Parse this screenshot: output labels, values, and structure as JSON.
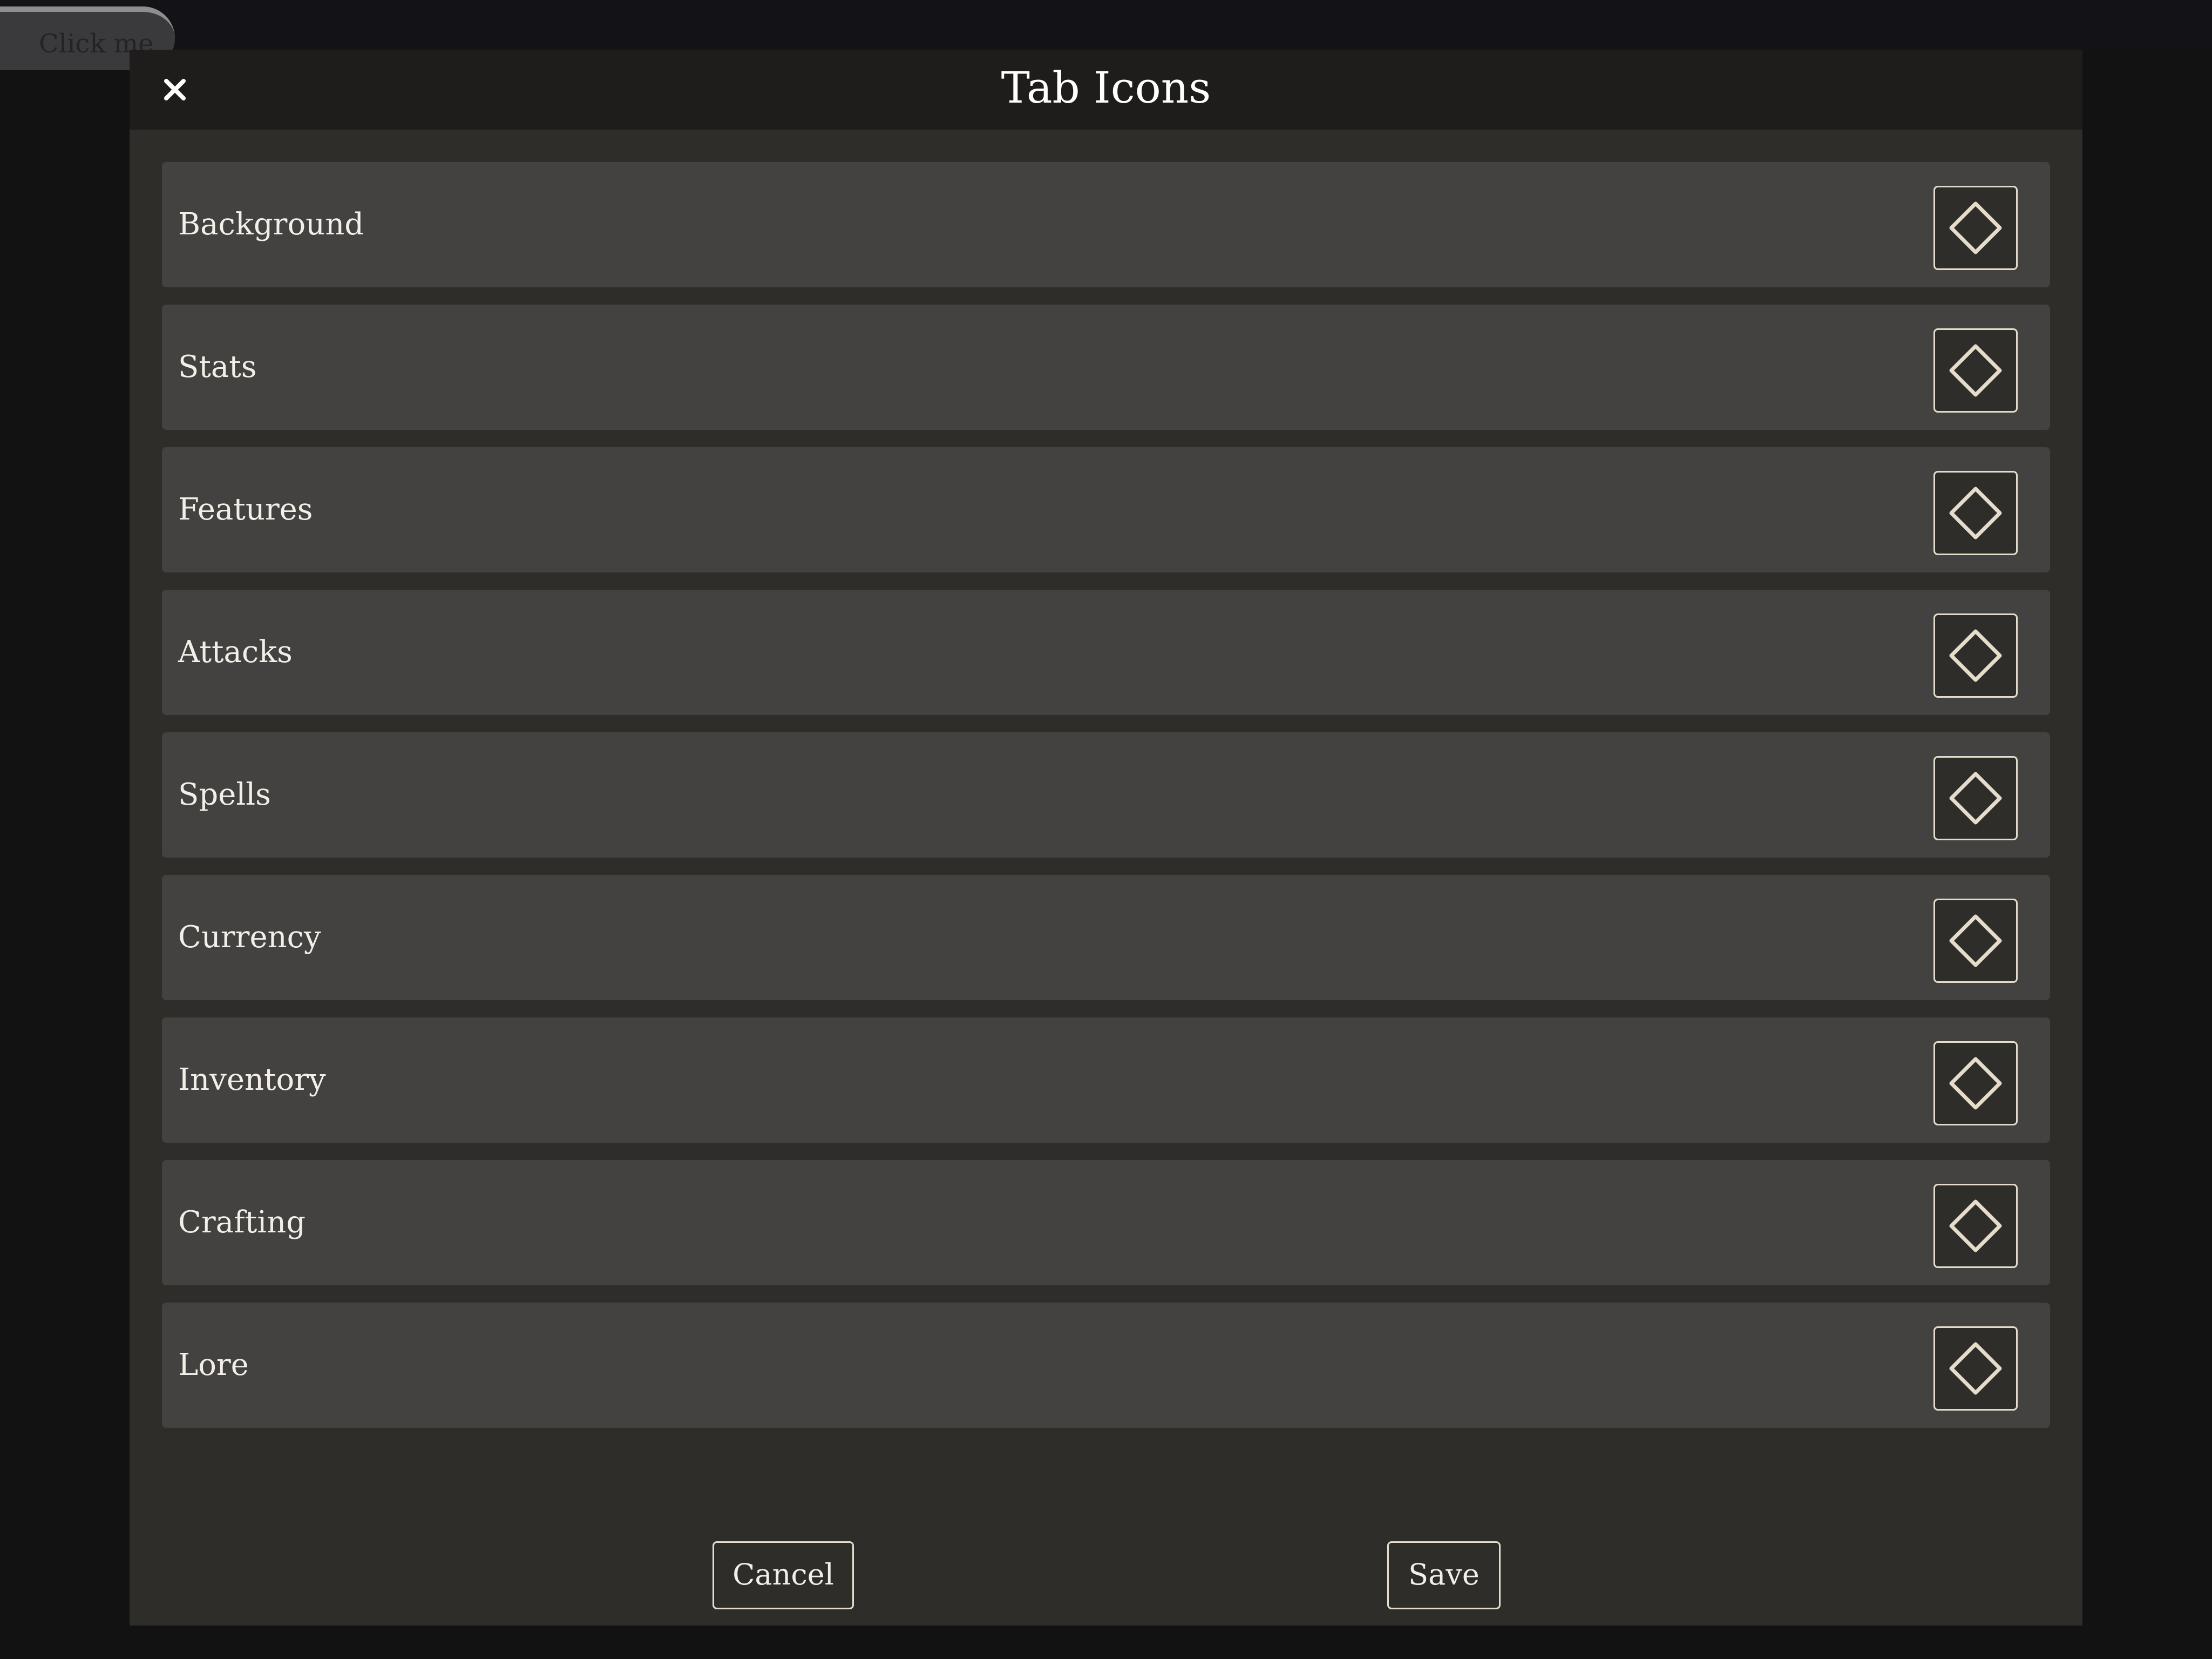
{
  "background_button": {
    "label": "Click me"
  },
  "modal": {
    "title": "Tab Icons",
    "close_icon": "close-icon",
    "rows": [
      {
        "label": "Background",
        "icon": "diamond-icon"
      },
      {
        "label": "Stats",
        "icon": "diamond-icon"
      },
      {
        "label": "Features",
        "icon": "diamond-icon"
      },
      {
        "label": "Attacks",
        "icon": "diamond-icon"
      },
      {
        "label": "Spells",
        "icon": "diamond-icon"
      },
      {
        "label": "Currency",
        "icon": "diamond-icon"
      },
      {
        "label": "Inventory",
        "icon": "diamond-icon"
      },
      {
        "label": "Crafting",
        "icon": "diamond-icon"
      },
      {
        "label": "Lore",
        "icon": "diamond-icon"
      }
    ],
    "cancel_label": "Cancel",
    "save_label": "Save"
  },
  "colors": {
    "page_background": "#121212",
    "modal_background": "#2e2d2a",
    "header_background": "#1e1d1b",
    "row_background": "#434240",
    "accent_border": "#e5dccb",
    "text": "#f3efe8"
  }
}
